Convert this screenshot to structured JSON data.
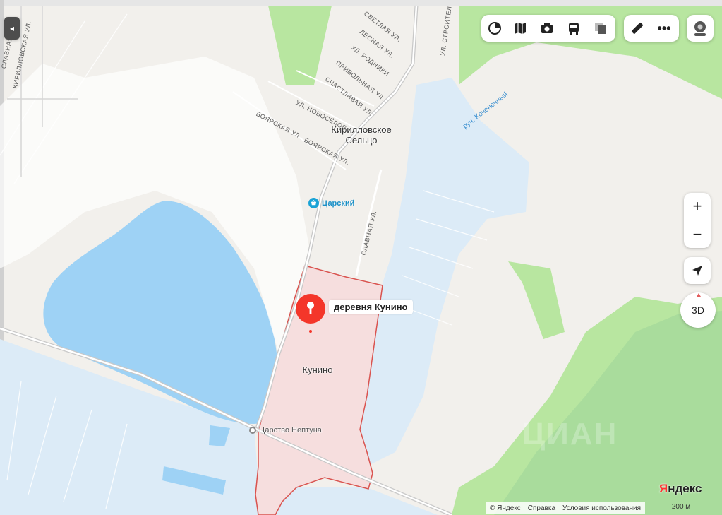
{
  "map": {
    "places": {
      "village_top_line1": "Кирилловское",
      "village_top_line2": "Сельцо",
      "village_main": "Кунино",
      "shop": "Царский",
      "bus_stop": "Царство Нептуна",
      "pin_label": "деревня Кунино"
    },
    "streets": {
      "svetlaya": "Светлая ул.",
      "lesnaya": "Лесная ул.",
      "rodniki": "ул. Родники",
      "privolnaya": "Привольная ул.",
      "schastlivaya": "Счастливая ул.",
      "novoselov": "ул. Новосёлов",
      "boyarskaya_1": "Боярская ул.",
      "boyarskaya_2": "Боярская ул.",
      "slavnaya": "Славная ул.",
      "kirillovskaya": "Кирилловская ул.",
      "stroitel": "ул. Строител",
      "slavnaya_left": "Славная ул.",
      "creek": "руч. Коченечный"
    },
    "colors": {
      "water": "#9ed2f5",
      "wetland": "#dcebf7",
      "forest": "#b8e6a0",
      "forest_dark": "#a9dc9c",
      "area_fill": "#f6dede",
      "area_border": "#d9534f",
      "pin": "#f4362a",
      "shop_icon": "#1aa3d6"
    }
  },
  "toolbar": {
    "buttons": [
      "layers-icon",
      "map-type-icon",
      "panorama-icon",
      "transit-icon",
      "traffic-icon"
    ],
    "ruler": "ruler-icon",
    "more": "more-icon"
  },
  "controls": {
    "zoom_in": "+",
    "zoom_out": "−",
    "three_d": "3D",
    "collapse": "◂"
  },
  "footer": {
    "brand": "Яндекс",
    "copyright": "© Яндекс",
    "help": "Справка",
    "terms": "Условия использования",
    "scale": "200 м",
    "watermark": "ЦИАН"
  }
}
